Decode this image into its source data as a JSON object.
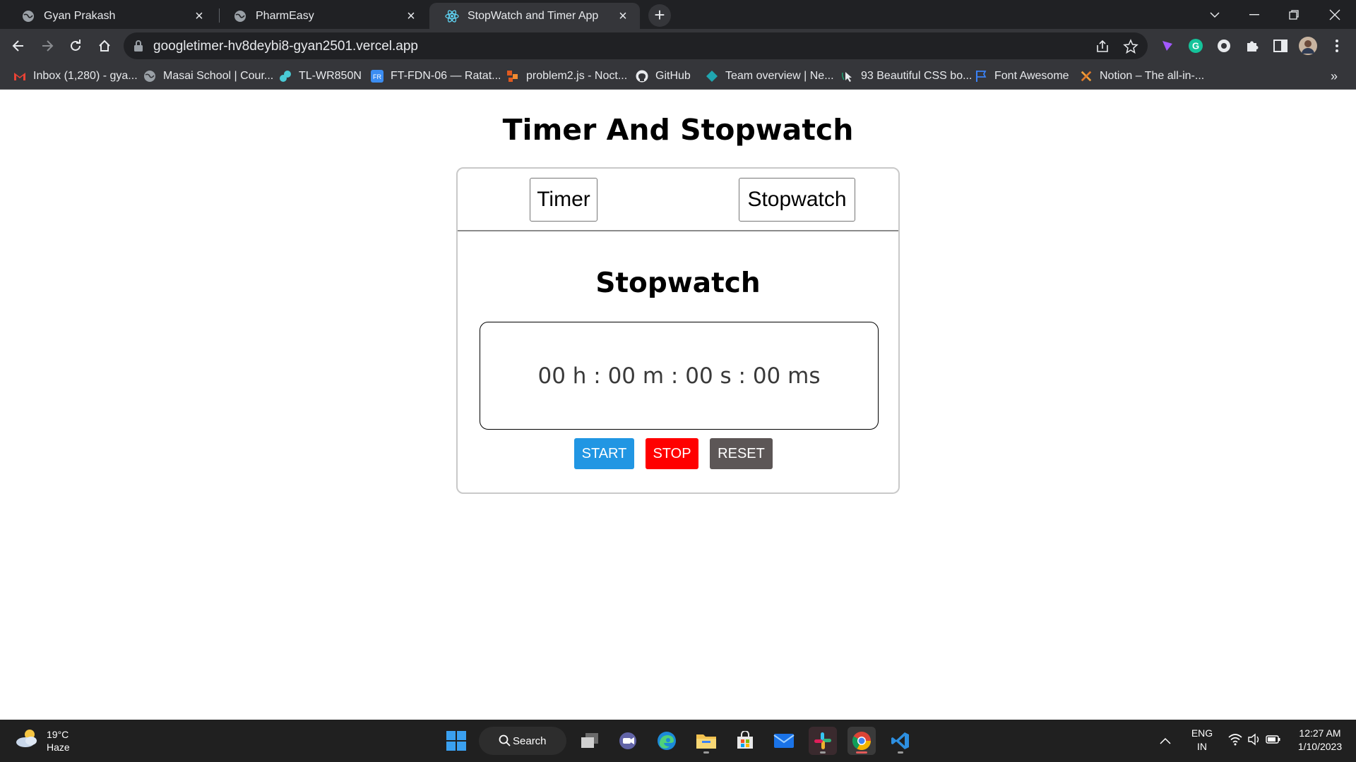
{
  "browser": {
    "tabs": [
      {
        "title": "Gyan Prakash",
        "active": false
      },
      {
        "title": "PharmEasy",
        "active": false
      },
      {
        "title": "StopWatch and Timer App",
        "active": true
      }
    ],
    "url": "googletimer-hv8deybi8-gyan2501.vercel.app",
    "bookmarks": [
      {
        "label": "Inbox (1,280) - gya...",
        "icon": "gmail-icon"
      },
      {
        "label": "Masai School | Cour...",
        "icon": "globe-icon"
      },
      {
        "label": "TL-WR850N",
        "icon": "tplink-icon"
      },
      {
        "label": "FT-FDN-06 — Ratat...",
        "icon": "app-icon"
      },
      {
        "label": "problem2.js - Noct...",
        "icon": "code-icon"
      },
      {
        "label": "GitHub",
        "icon": "github-icon"
      },
      {
        "label": "Team overview | Ne...",
        "icon": "netlify-icon"
      },
      {
        "label": "93 Beautiful CSS bo...",
        "icon": "cursor-icon"
      },
      {
        "label": "Font Awesome",
        "icon": "flag-icon"
      },
      {
        "label": "Notion – The all-in-...",
        "icon": "tools-icon"
      }
    ],
    "bookmarks_more": "»"
  },
  "page": {
    "title": "Timer And Stopwatch",
    "tabs": {
      "timer": "Timer",
      "stopwatch": "Stopwatch"
    },
    "section_title": "Stopwatch",
    "display": "00 h : 00 m : 00 s : 00 ms",
    "buttons": {
      "start": "START",
      "stop": "STOP",
      "reset": "RESET"
    },
    "colors": {
      "start": "#2196e3",
      "stop": "#ff0000",
      "reset": "#5c5656"
    }
  },
  "taskbar": {
    "weather": {
      "temp": "19°C",
      "condition": "Haze"
    },
    "search_label": "Search",
    "lang": {
      "line1": "ENG",
      "line2": "IN"
    },
    "clock": {
      "time": "12:27 AM",
      "date": "1/10/2023"
    }
  }
}
